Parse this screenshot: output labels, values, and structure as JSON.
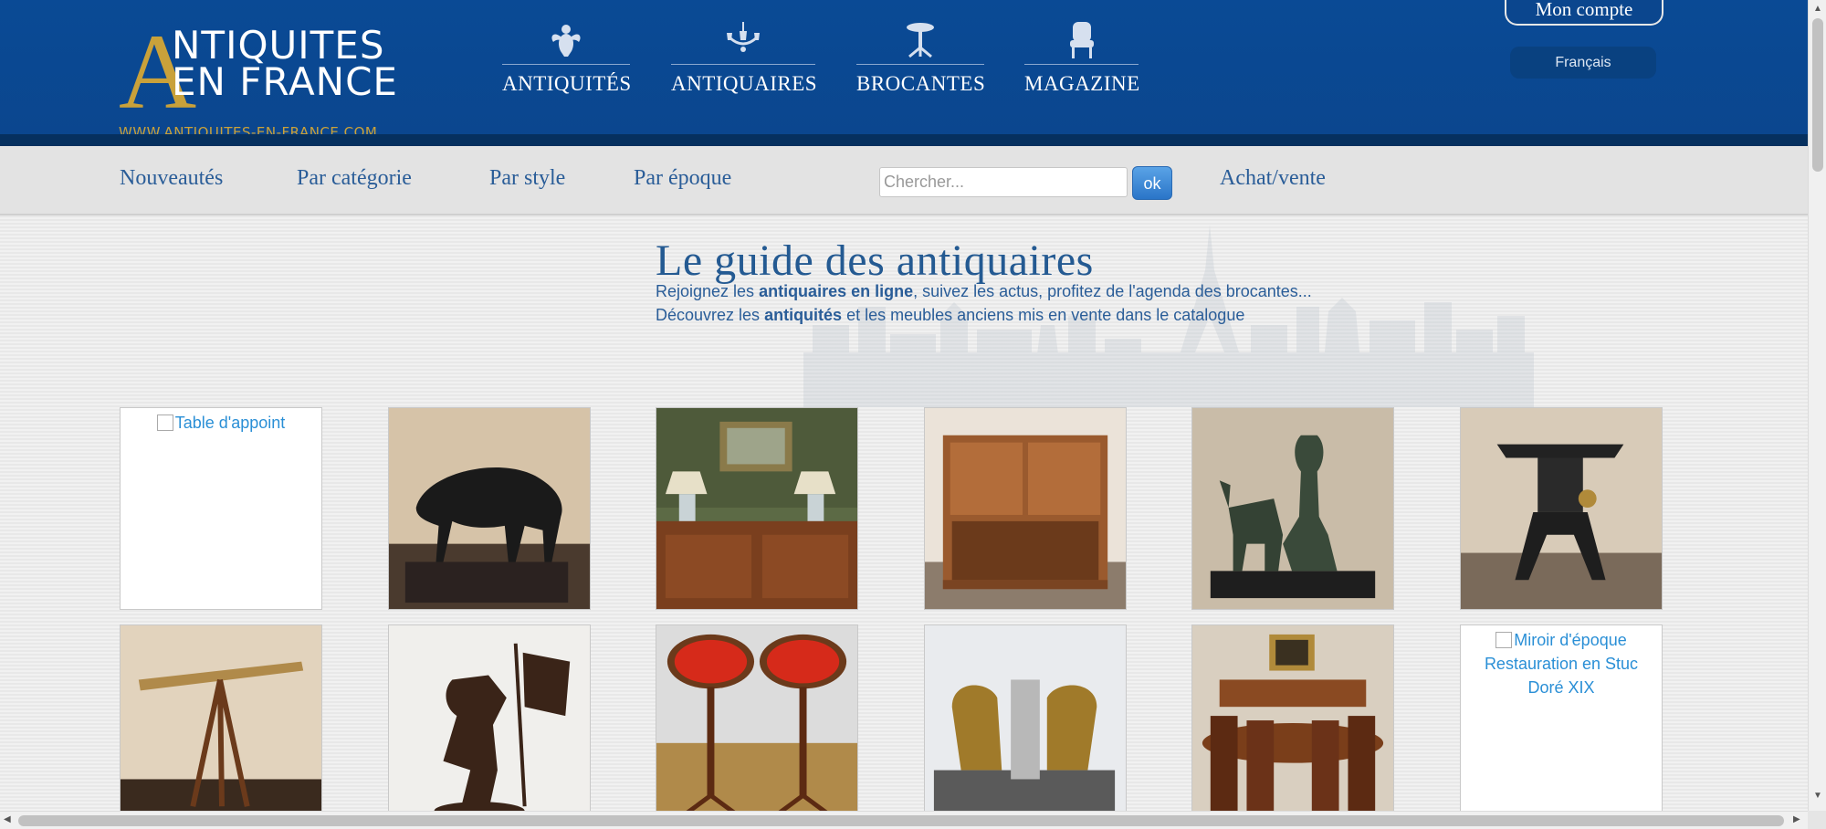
{
  "header": {
    "logo": {
      "big_letter": "A",
      "line1": "NTIQUITES",
      "line2": "EN FRANCE",
      "url": "WWW.ANTIQUITES-EN-FRANCE.COM"
    },
    "nav": [
      {
        "label": "ANTIQUITÉS",
        "icon": "cherub-icon"
      },
      {
        "label": "ANTIQUAIRES",
        "icon": "chandelier-icon"
      },
      {
        "label": "BROCANTES",
        "icon": "pedestal-table-icon"
      },
      {
        "label": "MAGAZINE",
        "icon": "armchair-icon"
      }
    ],
    "account_label": "Mon compte",
    "language": "Français"
  },
  "subnav": {
    "links": [
      "Nouveautés",
      "Par catégorie",
      "Par style",
      "Par époque"
    ],
    "search_placeholder": "Chercher...",
    "search_button": "ok",
    "achat_vente": "Achat/vente"
  },
  "intro": {
    "title": "Le guide des antiquaires",
    "line1_a": "Rejoignez les ",
    "line1_b": "antiquaires en ligne",
    "line1_c": ", suivez les actus, profitez de l'agenda des brocantes...",
    "line2_a": "Découvrez les ",
    "line2_b": "antiquités",
    "line2_c": " et les meubles anciens mis en vente dans le catalogue"
  },
  "gallery": {
    "row1": [
      {
        "alt": "Table d'appoint",
        "broken": true
      },
      {
        "alt": "",
        "broken": false
      },
      {
        "alt": "",
        "broken": false
      },
      {
        "alt": "",
        "broken": false
      },
      {
        "alt": "",
        "broken": false
      },
      {
        "alt": "",
        "broken": false
      }
    ],
    "row2": [
      {
        "alt": "",
        "broken": false
      },
      {
        "alt": "",
        "broken": false
      },
      {
        "alt": "",
        "broken": false
      },
      {
        "alt": "",
        "broken": false
      },
      {
        "alt": "",
        "broken": false
      },
      {
        "alt": "Miroir d'époque Restauration en Stuc Doré XIX",
        "broken": true
      }
    ]
  },
  "colors": {
    "header_blue": "#0a4a95",
    "gold": "#c9a13a",
    "link_blue": "#2a5d98",
    "alt_text_blue": "#2a8fd6"
  }
}
